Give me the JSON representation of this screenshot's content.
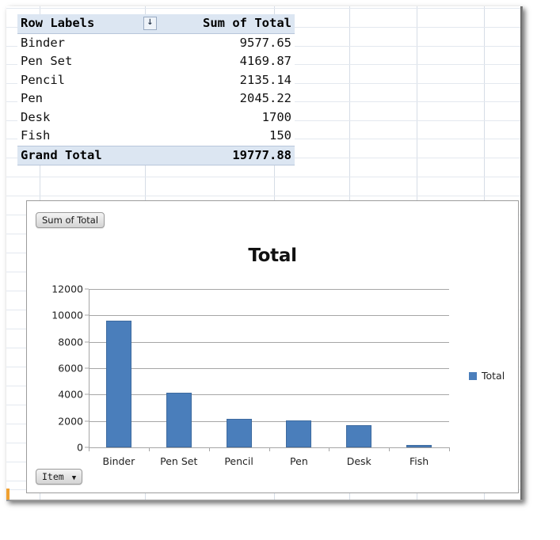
{
  "pivot_table": {
    "headers": [
      "Row Labels",
      "Sum of Total"
    ],
    "filter_icon": "↓",
    "rows": [
      {
        "label": "Binder",
        "value": "9577.65"
      },
      {
        "label": "Pen Set",
        "value": "4169.87"
      },
      {
        "label": "Pencil",
        "value": "2135.14"
      },
      {
        "label": "Pen",
        "value": "2045.22"
      },
      {
        "label": "Desk",
        "value": "1700"
      },
      {
        "label": "Fish",
        "value": "150"
      }
    ],
    "grand_total": {
      "label": "Grand Total",
      "value": "19777.88"
    },
    "header_fill": "#dce6f2"
  },
  "chart_object": {
    "value_field_button": "Sum of Total",
    "axis_field_button": "Item",
    "axis_field_arrow": "▼"
  },
  "chart_data": {
    "type": "bar",
    "title": "Total",
    "xlabel": "",
    "ylabel": "",
    "categories": [
      "Binder",
      "Pen Set",
      "Pencil",
      "Pen",
      "Desk",
      "Fish"
    ],
    "series": [
      {
        "name": "Total",
        "values": [
          9577.65,
          4169.87,
          2135.14,
          2045.22,
          1700,
          150
        ],
        "color": "#4a7ebb"
      }
    ],
    "ylim": [
      0,
      12000
    ],
    "yticks": [
      0,
      2000,
      4000,
      6000,
      8000,
      10000,
      12000
    ],
    "ytick_labels": [
      "0",
      "2000",
      "4000",
      "6000",
      "8000",
      "10000",
      "12000"
    ],
    "grid": true,
    "legend": {
      "position": "right",
      "entries": [
        "Total"
      ]
    }
  }
}
